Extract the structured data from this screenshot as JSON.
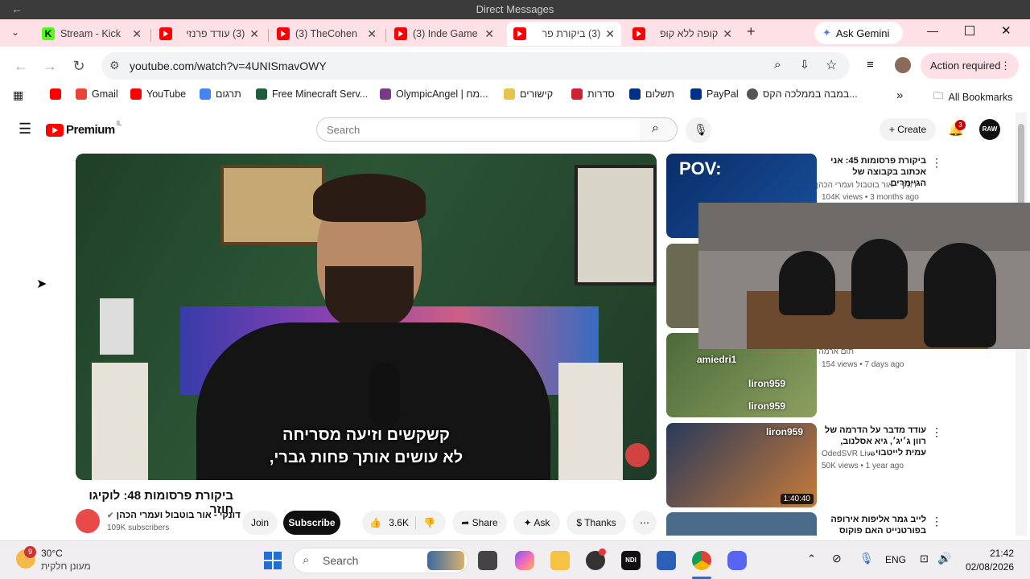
{
  "os": {
    "window_title": "Direct Messages"
  },
  "tabs": [
    {
      "label": "Stream - Kick",
      "icon": "kick"
    },
    {
      "label": "(3) עודד פרנזי",
      "icon": "youtube"
    },
    {
      "label": "(3) TheCohen",
      "icon": "youtube"
    },
    {
      "label": "(3) Inde Game",
      "icon": "youtube"
    },
    {
      "label": "(3) ביקורת פר",
      "icon": "youtube",
      "active": true
    },
    {
      "label": "קופה ללא קופ",
      "icon": "youtube"
    }
  ],
  "browser": {
    "new_tab": "+",
    "ask_gemini": "Ask Gemini",
    "url": "youtube.com/watch?v=4UNISmavOWY",
    "action_required": "Action required"
  },
  "bookmarks": {
    "items": [
      "Gmail",
      "YouTube",
      "תרגום",
      "Free Minecraft Serv...",
      "OlympicAngel | מח...",
      "קישורים",
      "סדרות",
      "תשלום",
      "PayPal",
      "במבה בממלכה הקס..."
    ],
    "more": "»",
    "all": "All Bookmarks"
  },
  "yt": {
    "logo": "Premium",
    "country": "IL",
    "search_placeholder": "Search",
    "create": "Create",
    "notif_count": "3",
    "avatar_text": "RAW"
  },
  "video": {
    "subtitle_line1": "קשקשים וזיעה מסריחה",
    "subtitle_line2": "לא עושים אותך פחות גברי,",
    "title": "ביקורת פרסומות 48: לוקיגו חוזר",
    "channel": "דונקי - אור בוטבול ועמרי הכהן",
    "subscribers": "109K subscribers",
    "join": "Join",
    "subscribe": "Subscribe",
    "likes": "3.6K",
    "share": "Share",
    "ask": "Ask",
    "thanks": "Thanks"
  },
  "recs": [
    {
      "title": "ביקורת פרסומות 45: אני אכתוב בקבוצה של הגיימרים",
      "channel": "דונקי - אור בוטבול ועמרי הכהן",
      "meta": "104K views • 3 months ago",
      "thumb_text": "POV:"
    },
    {
      "title": "",
      "channel": "תום ארמה",
      "meta": "154 views • 7 days ago"
    },
    {
      "title": "עודד מדבר על הדרמה של רוון ג׳יג׳, גיא אסלנוב, עמית לייטבוי...",
      "channel": "OdedSVR Live",
      "meta": "50K views • 1 year ago",
      "duration": "1:40:40"
    },
    {
      "title": "לייב גמר אליפות אירופה בפורטנייט האם פוקוס ינצח...",
      "channel": "",
      "meta": ""
    }
  ],
  "overlay_chat": [
    "amiedri1",
    "liron959",
    "liron959",
    "liron959"
  ],
  "taskbar": {
    "weather_temp": "30°C",
    "weather_desc": "מעונן חלקית",
    "weather_badge": "9",
    "search": "Search",
    "lang": "ENG",
    "time": "21:42",
    "date": "02/08/2026"
  },
  "colors": {
    "accent": "#ff0000",
    "tabstrip": "#fde1e6",
    "kick": "#53fc18"
  }
}
